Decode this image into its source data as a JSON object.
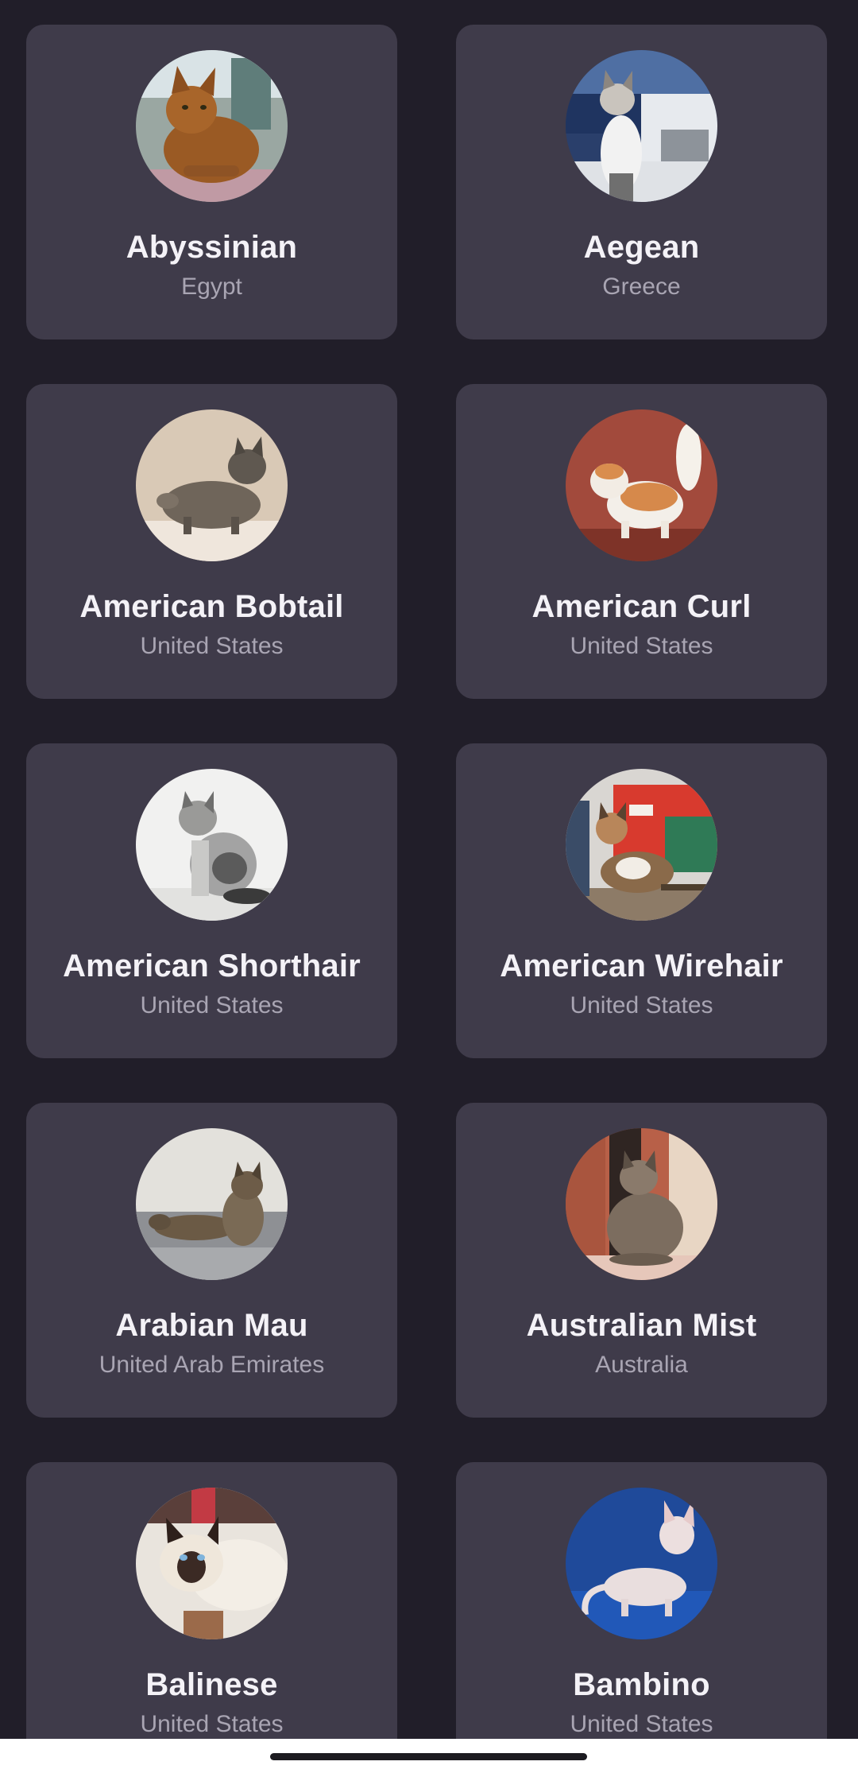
{
  "breeds": [
    {
      "name": "Abyssinian",
      "origin": "Egypt",
      "photo": "cat-photo-abyssinian"
    },
    {
      "name": "Aegean",
      "origin": "Greece",
      "photo": "cat-photo-aegean"
    },
    {
      "name": "American Bobtail",
      "origin": "United States",
      "photo": "cat-photo-american-bobtail"
    },
    {
      "name": "American Curl",
      "origin": "United States",
      "photo": "cat-photo-american-curl"
    },
    {
      "name": "American Shorthair",
      "origin": "United States",
      "photo": "cat-photo-american-shorthair"
    },
    {
      "name": "American Wirehair",
      "origin": "United States",
      "photo": "cat-photo-american-wirehair"
    },
    {
      "name": "Arabian Mau",
      "origin": "United Arab Emirates",
      "photo": "cat-photo-arabian-mau"
    },
    {
      "name": "Australian Mist",
      "origin": "Australia",
      "photo": "cat-photo-australian-mist"
    },
    {
      "name": "Balinese",
      "origin": "United States",
      "photo": "cat-photo-balinese"
    },
    {
      "name": "Bambino",
      "origin": "United States",
      "photo": "cat-photo-bambino"
    }
  ],
  "colors": {
    "background": "#211e29",
    "card": "#3f3b4a",
    "name_text": "#f4f2f7",
    "origin_text": "#a9a5b3"
  }
}
